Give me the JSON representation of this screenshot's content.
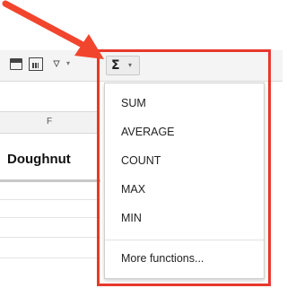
{
  "toolbar": {
    "icons": [
      "sheet-icon",
      "chart-icon",
      "filter-icon"
    ],
    "sigma_symbol": "Σ",
    "sigma_caret": "▾",
    "filter_caret": "▾"
  },
  "sheet": {
    "column_letter": "F",
    "column_name": "Doughnut"
  },
  "functions_menu": {
    "items": [
      "SUM",
      "AVERAGE",
      "COUNT",
      "MAX",
      "MIN"
    ],
    "more": "More functions..."
  },
  "colors": {
    "highlight": "#e8382c",
    "arrow": "#f2452d"
  }
}
